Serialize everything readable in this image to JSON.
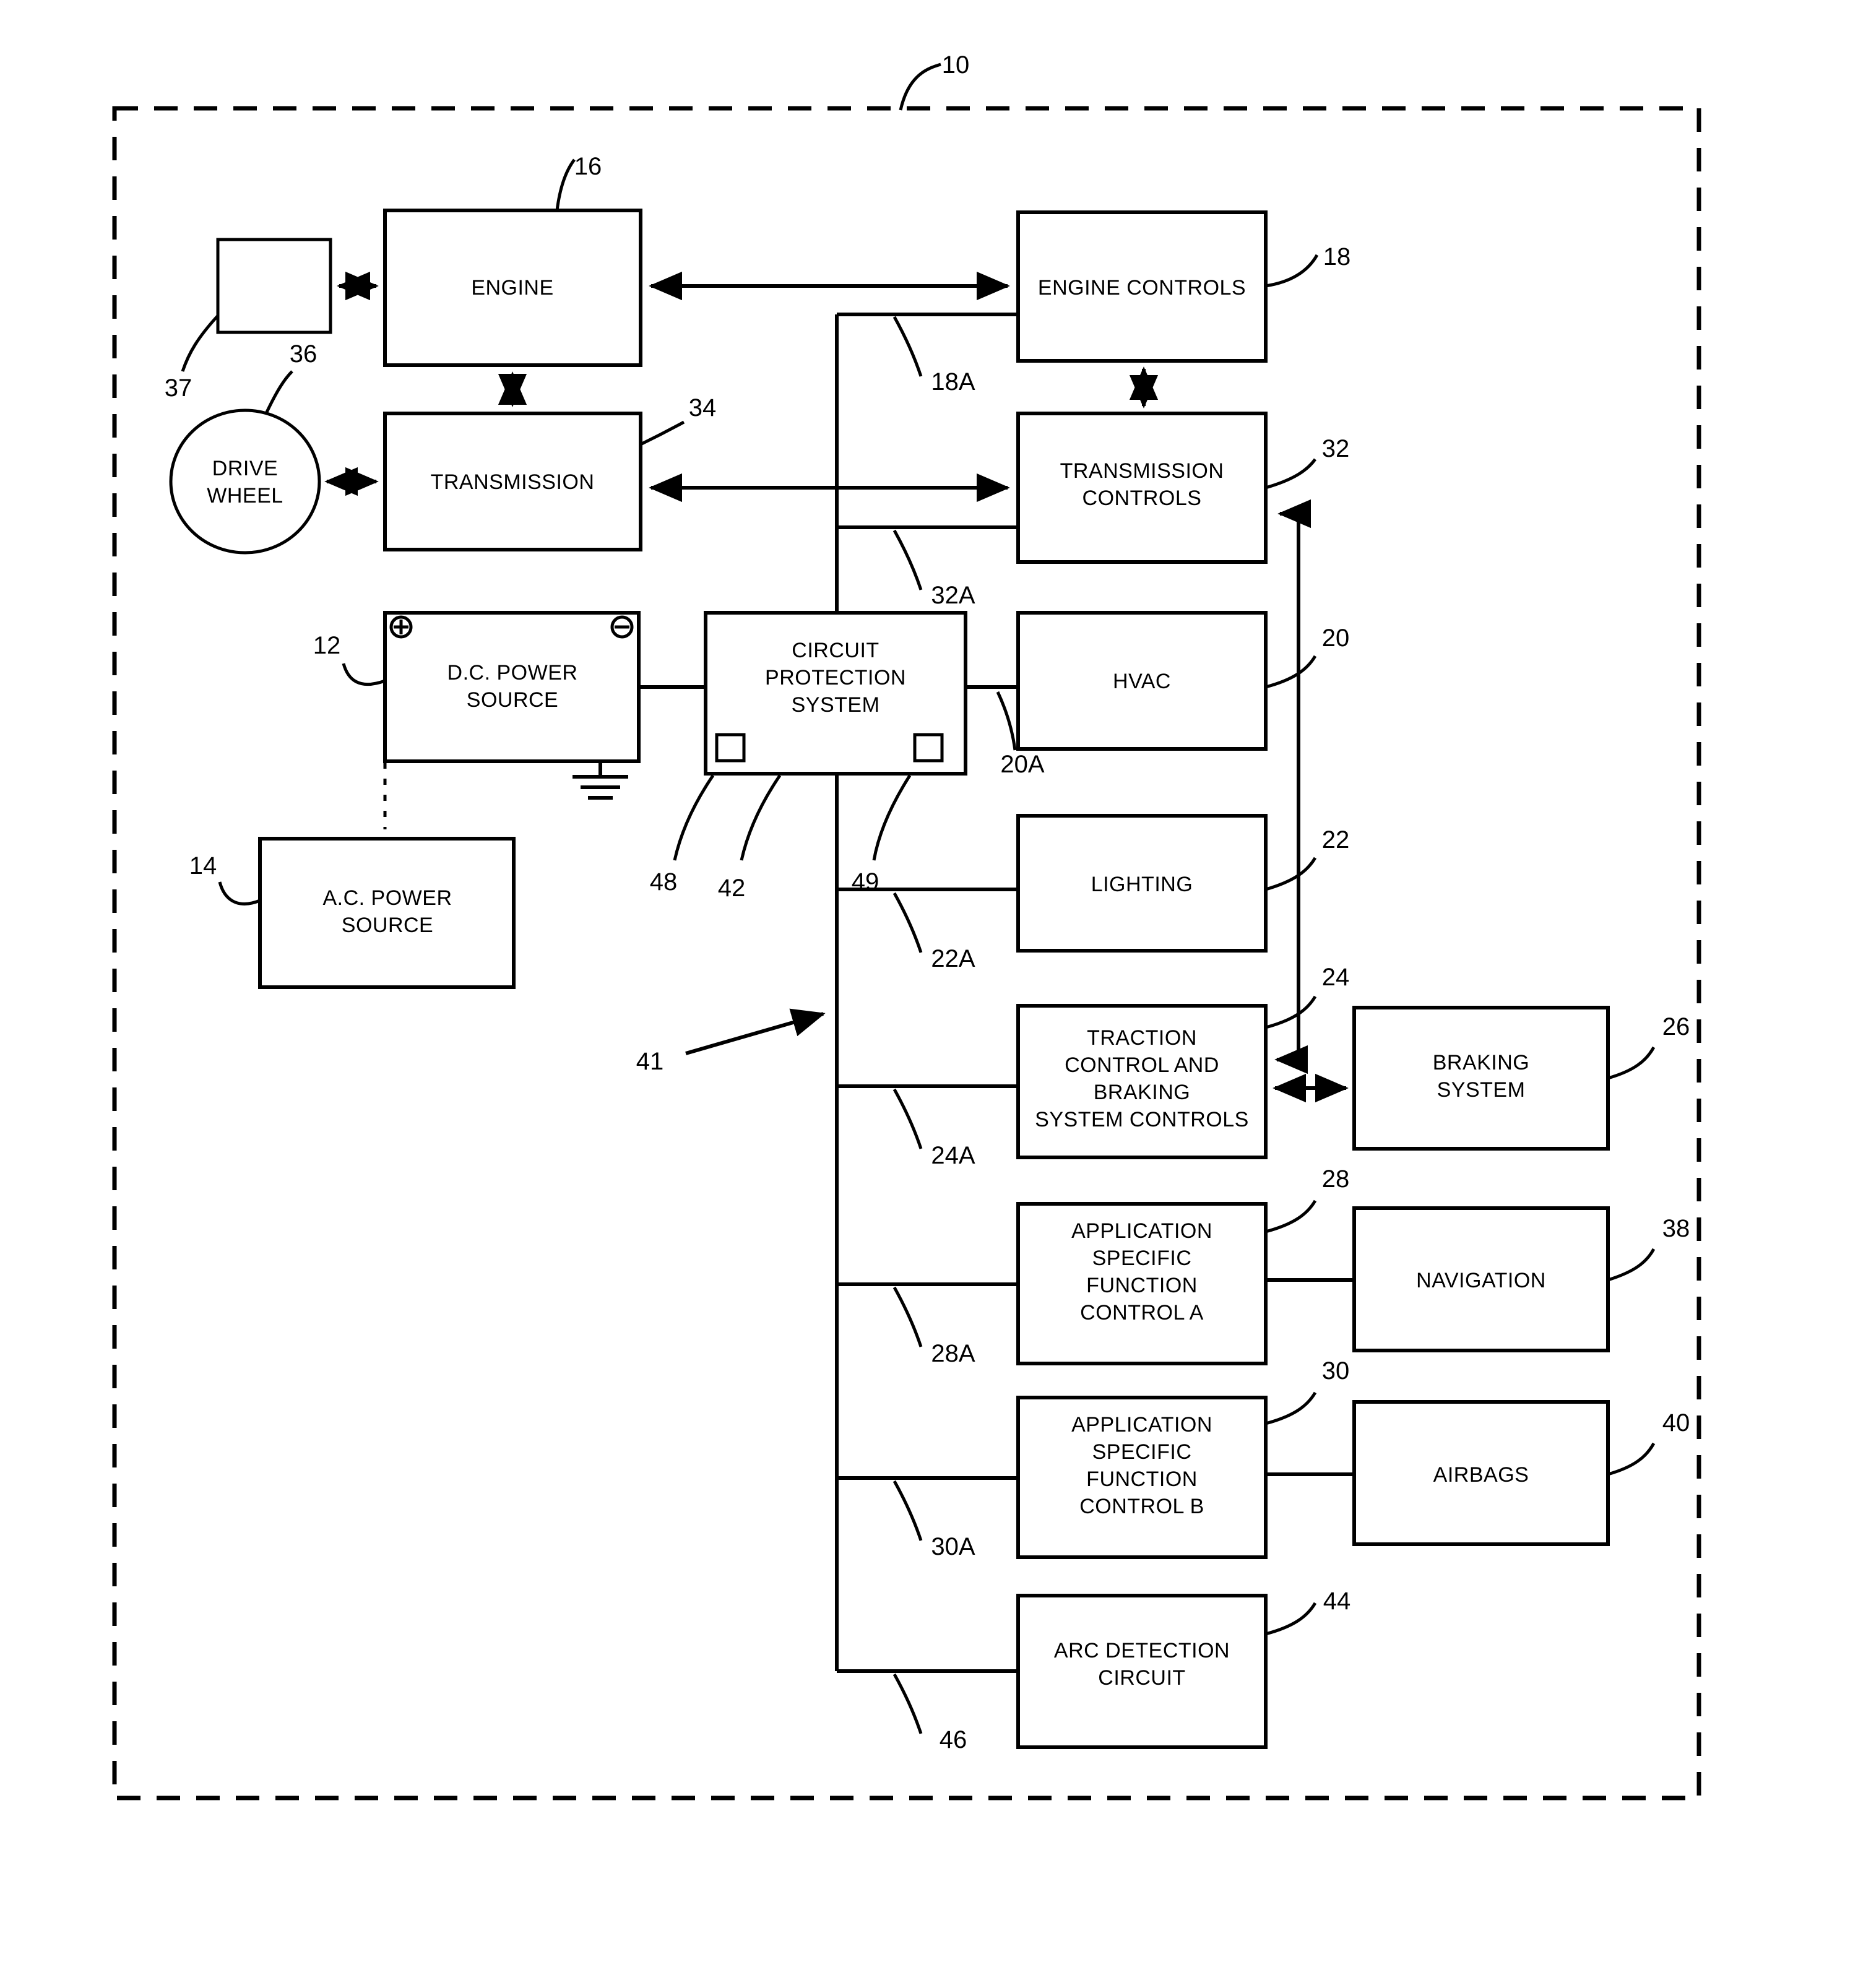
{
  "figure": {
    "frame_ref": "10",
    "bus_ref": "41"
  },
  "blocks": {
    "unlabeled_small": {
      "label": "",
      "ref": "37"
    },
    "engine": {
      "label": "ENGINE",
      "ref": "16"
    },
    "engine_controls": {
      "label": "ENGINE CONTROLS",
      "ref": "18",
      "feed_ref": "18A"
    },
    "drive_wheel": {
      "label_line1": "DRIVE",
      "label_line2": "WHEEL",
      "ref": "36"
    },
    "transmission": {
      "label": "TRANSMISSION",
      "ref": "34"
    },
    "transmission_controls": {
      "label_line1": "TRANSMISSION",
      "label_line2": "CONTROLS",
      "ref": "32",
      "feed_ref": "32A"
    },
    "dc_power_source": {
      "label_line1": "D.C. POWER",
      "label_line2": "SOURCE",
      "ref": "12",
      "plus": "⊕",
      "minus": "⊖"
    },
    "ac_power_source": {
      "label_line1": "A.C. POWER",
      "label_line2": "SOURCE",
      "ref": "14"
    },
    "circuit_protection_system": {
      "label_line1": "CIRCUIT",
      "label_line2": "PROTECTION",
      "label_line3": "SYSTEM",
      "ref": "42",
      "left_terminal_ref": "48",
      "right_terminal_ref": "49"
    },
    "hvac": {
      "label": "HVAC",
      "ref": "20",
      "feed_ref": "20A"
    },
    "lighting": {
      "label": "LIGHTING",
      "ref": "22",
      "feed_ref": "22A"
    },
    "traction_control": {
      "label_line1": "TRACTION",
      "label_line2": "CONTROL AND",
      "label_line3": "BRAKING",
      "label_line4": "SYSTEM CONTROLS",
      "ref": "24",
      "feed_ref": "24A"
    },
    "braking_system": {
      "label_line1": "BRAKING",
      "label_line2": "SYSTEM",
      "ref": "26"
    },
    "asf_control_a": {
      "label_line1": "APPLICATION",
      "label_line2": "SPECIFIC",
      "label_line3": "FUNCTION",
      "label_line4": "CONTROL A",
      "ref": "28",
      "feed_ref": "28A"
    },
    "navigation": {
      "label": "NAVIGATION",
      "ref": "38"
    },
    "asf_control_b": {
      "label_line1": "APPLICATION",
      "label_line2": "SPECIFIC",
      "label_line3": "FUNCTION",
      "label_line4": "CONTROL B",
      "ref": "30",
      "feed_ref": "30A"
    },
    "airbags": {
      "label": "AIRBAGS",
      "ref": "40"
    },
    "arc_detection_circuit": {
      "label_line1": "ARC DETECTION",
      "label_line2": "CIRCUIT",
      "ref": "44",
      "feed_ref": "46"
    }
  },
  "colors": {
    "ink": "#000000",
    "paper": "#ffffff"
  }
}
